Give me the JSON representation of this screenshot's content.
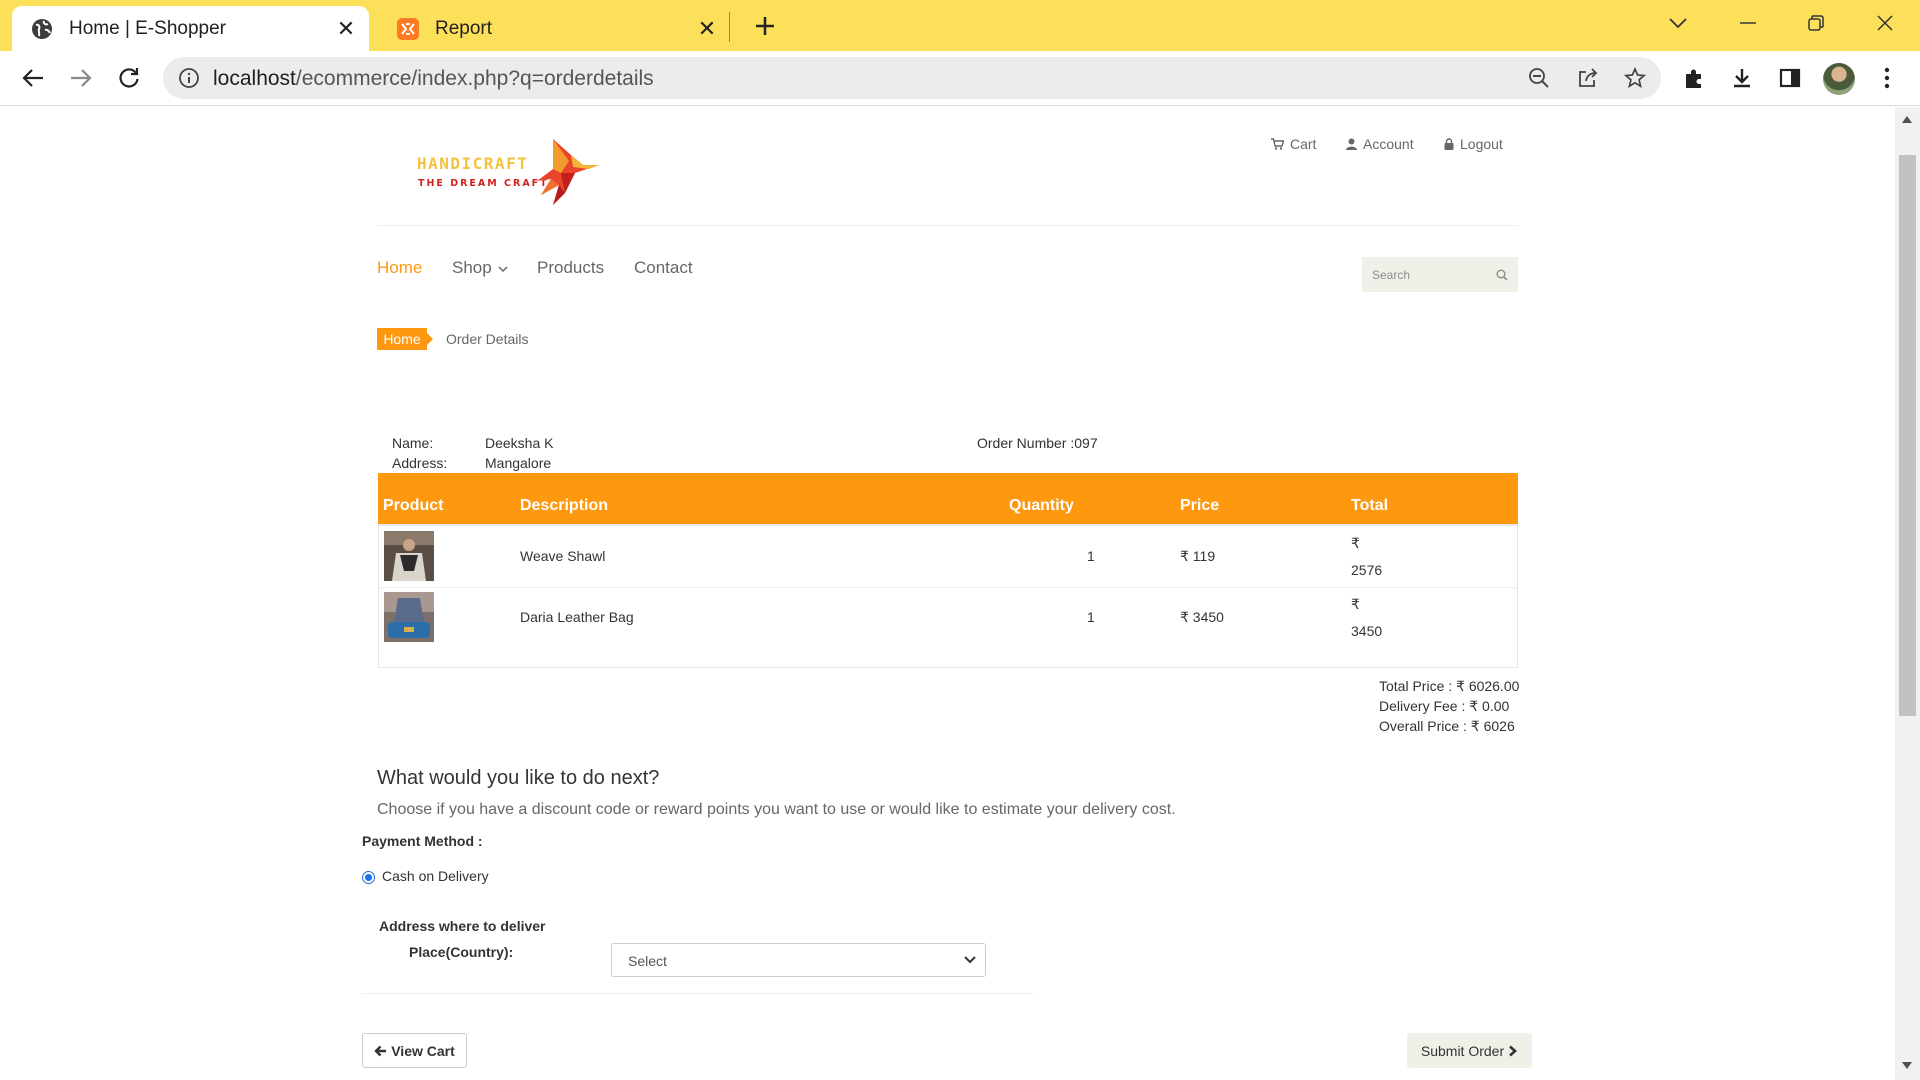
{
  "browser": {
    "tabs": [
      {
        "title": "Home | E-Shopper",
        "active": true,
        "icon": "globe-icon"
      },
      {
        "title": "Report",
        "active": false,
        "icon": "xampp-icon"
      }
    ],
    "url_host": "localhost",
    "url_path": "/ecommerce/index.php?q=orderdetails",
    "accent": "#fde05a"
  },
  "site": {
    "logo": {
      "brand": "HANDICRAFT",
      "tagline": "THE DREAM CRAFT"
    },
    "top_links": {
      "cart": "Cart",
      "account": "Account",
      "logout": "Logout"
    },
    "nav": {
      "home": "Home",
      "shop": "Shop",
      "products": "Products",
      "contact": "Contact"
    },
    "search_placeholder": "Search",
    "accent": "#fe980f"
  },
  "breadcrumb": {
    "home": "Home",
    "current": "Order Details"
  },
  "order": {
    "name_label": "Name:",
    "name": "Deeksha K",
    "address_label": "Address:",
    "address": "Mangalore",
    "order_number": "Order Number :097"
  },
  "table": {
    "headers": {
      "product": "Product",
      "description": "Description",
      "quantity": "Quantity",
      "price": "Price",
      "total": "Total"
    },
    "rows": [
      {
        "description": "Weave Shawl",
        "quantity": "1",
        "price": "₹ 119",
        "total_symbol": "₹",
        "total": "2576"
      },
      {
        "description": "Daria Leather Bag",
        "quantity": "1",
        "price": "₹ 3450",
        "total_symbol": "₹",
        "total": "3450"
      }
    ]
  },
  "totals": {
    "total_price": "Total Price : ₹ 6026.00",
    "delivery_fee": "Delivery Fee : ₹ 0.00",
    "overall_price": "Overall Price : ₹ 6026"
  },
  "next": {
    "title": "What would you like to do next?",
    "subtitle": "Choose if you have a discount code or reward points you want to use or would like to estimate your delivery cost."
  },
  "payment": {
    "label": "Payment Method :",
    "option": "Cash on Delivery",
    "selected": true
  },
  "delivery": {
    "heading": "Address where to deliver",
    "place_label": "Place(Country):",
    "place_value": "Select"
  },
  "buttons": {
    "view_cart": "View Cart",
    "submit_order": "Submit Order"
  }
}
